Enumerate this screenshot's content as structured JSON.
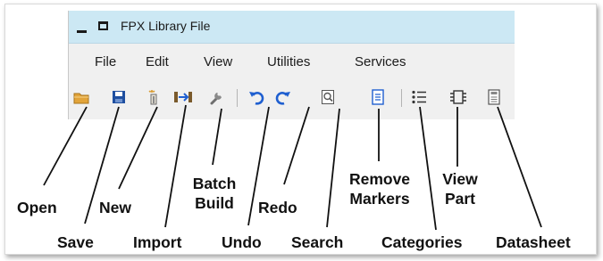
{
  "window": {
    "title": "FPX Library File"
  },
  "menu": {
    "file": "File",
    "edit": "Edit",
    "view": "View",
    "utilities": "Utilities",
    "services": "Services"
  },
  "toolbar": {
    "icons": [
      "open-folder-icon",
      "save-icon",
      "new-icon",
      "import-icon",
      "batch-build-icon",
      "undo-icon",
      "redo-icon",
      "search-icon",
      "remove-markers-icon",
      "categories-icon",
      "view-part-icon",
      "datasheet-icon"
    ]
  },
  "callouts": {
    "open": "Open",
    "save": "Save",
    "new": "New",
    "import": "Import",
    "batch_build_1": "Batch",
    "batch_build_2": "Build",
    "undo": "Undo",
    "redo": "Redo",
    "search": "Search",
    "remove_markers_1": "Remove",
    "remove_markers_2": "Markers",
    "categories": "Categories",
    "view_part_1": "View",
    "view_part_2": "Part",
    "datasheet": "Datasheet"
  },
  "colors": {
    "titlebar": "#cce8f4",
    "toolbar_bg": "#f0f0f0",
    "folder": "#e2a43a",
    "save": "#1f4fa0",
    "undo_redo": "#1f5fd0"
  }
}
